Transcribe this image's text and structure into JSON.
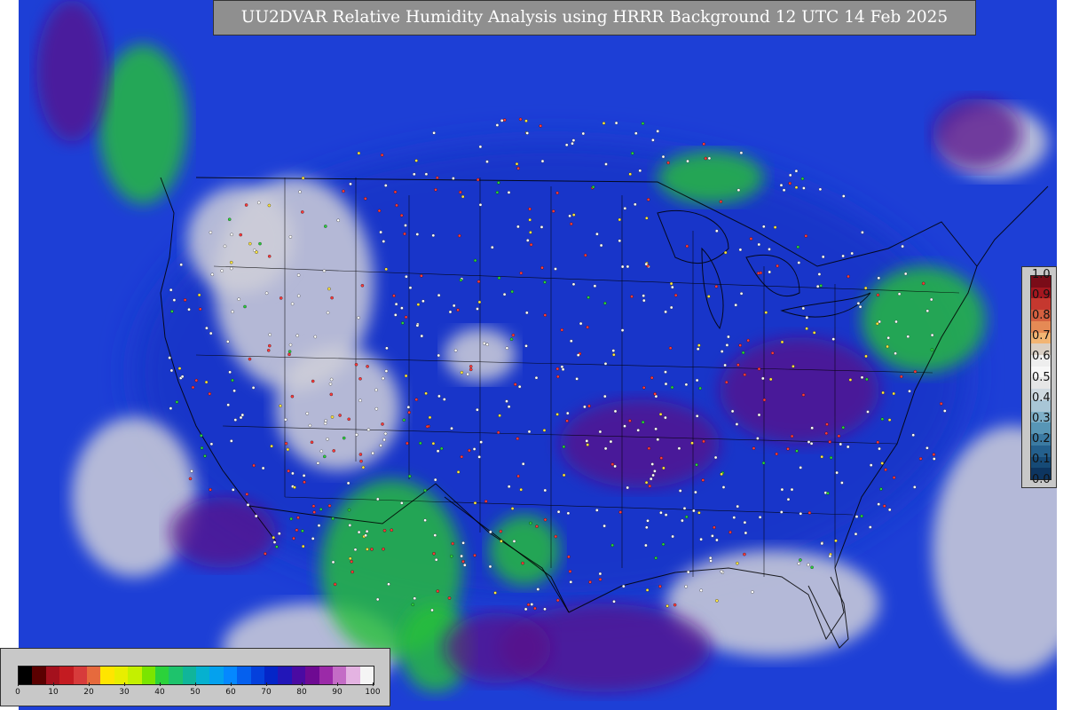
{
  "title": "UU2DVAR Relative Humidity Analysis using HRRR Background 12 UTC 14 Feb 2025",
  "map": {
    "ocean_color": "#1d3fd6",
    "land_moist_color": "#1535c8",
    "dry_color": "#cfcfd8",
    "moist_green_color": "#27c13a",
    "purple_color": "#5a0a8a",
    "boundary_color": "#000000",
    "station_marker_colors": [
      "#ffffff",
      "#ff3a3a",
      "#ffe640",
      "#2bd23b"
    ]
  },
  "increment_colorbar": {
    "tick_labels": [
      "1.0",
      "0.9",
      "0.8",
      "0.7",
      "0.6",
      "0.5",
      "0.4",
      "0.3",
      "0.2",
      "0.1",
      "0.0"
    ],
    "colors": [
      "#7a0c18",
      "#a4171f",
      "#c5382f",
      "#d4603f",
      "#e58a55",
      "#f2b573",
      "#d9cfc4",
      "#eeeeee",
      "#f7f7f7",
      "#e6e6e6",
      "#cfd9e0",
      "#a8c6d6",
      "#7fb0c9",
      "#5896b6",
      "#3b7aa2",
      "#24608d",
      "#164a76",
      "#0d3560"
    ]
  },
  "rh_colorbar": {
    "tick_labels": [
      "0",
      "10",
      "20",
      "30",
      "40",
      "50",
      "60",
      "70",
      "80",
      "90",
      "100"
    ],
    "colors": [
      "#000000",
      "#5a0000",
      "#a4101d",
      "#c41b21",
      "#d73b3b",
      "#e66a3d",
      "#ffe500",
      "#e8ee00",
      "#c4f000",
      "#7ae500",
      "#2bd23b",
      "#1ec36c",
      "#10b59a",
      "#06b1cf",
      "#04a1ee",
      "#0588ff",
      "#0560ee",
      "#0440dc",
      "#0425c8",
      "#2216b8",
      "#4a0aa2",
      "#6e0a92",
      "#9b2aa8",
      "#c46cc6",
      "#e4b3e2",
      "#f5f5f5"
    ]
  }
}
